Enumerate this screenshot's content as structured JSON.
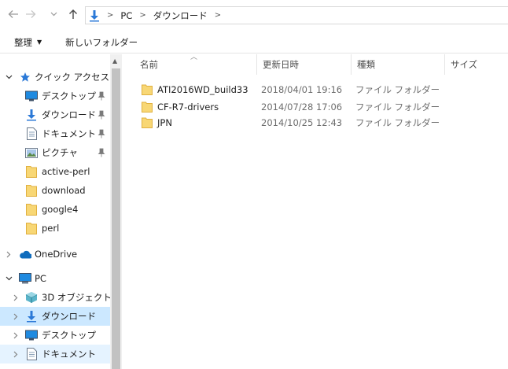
{
  "toolbar": {
    "back": "back",
    "forward": "forward",
    "recent": "recent-locations",
    "up": "up"
  },
  "address": {
    "crumbs": [
      "PC",
      "ダウンロード"
    ]
  },
  "ribbon": {
    "organize": "整理",
    "new_folder": "新しいフォルダー"
  },
  "nav": {
    "quick_access": "クイック アクセス",
    "desktop": "デスクトップ",
    "downloads": "ダウンロード",
    "documents": "ドキュメント",
    "pictures": "ピクチャ",
    "active_perl": "active-perl",
    "download": "download",
    "google4": "google4",
    "perl": "perl",
    "onedrive": "OneDrive",
    "pc": "PC",
    "objects3d": "3D オブジェクト",
    "pc_downloads": "ダウンロード",
    "pc_desktop": "デスクトップ",
    "pc_documents": "ドキュメント"
  },
  "columns": {
    "name": "名前",
    "modified": "更新日時",
    "type": "種類",
    "size": "サイズ"
  },
  "files": [
    {
      "name": "ATI2016WD_build33",
      "modified": "2018/04/01 19:16",
      "type": "ファイル フォルダー"
    },
    {
      "name": "CF-R7-drivers",
      "modified": "2014/07/28 17:06",
      "type": "ファイル フォルダー"
    },
    {
      "name": "JPN",
      "modified": "2014/10/25 12:43",
      "type": "ファイル フォルダー"
    }
  ],
  "colors": {
    "selected": "#cce8ff",
    "hover": "#e5f3ff",
    "folder": "#e8b548",
    "accent": "#2b79d7"
  }
}
